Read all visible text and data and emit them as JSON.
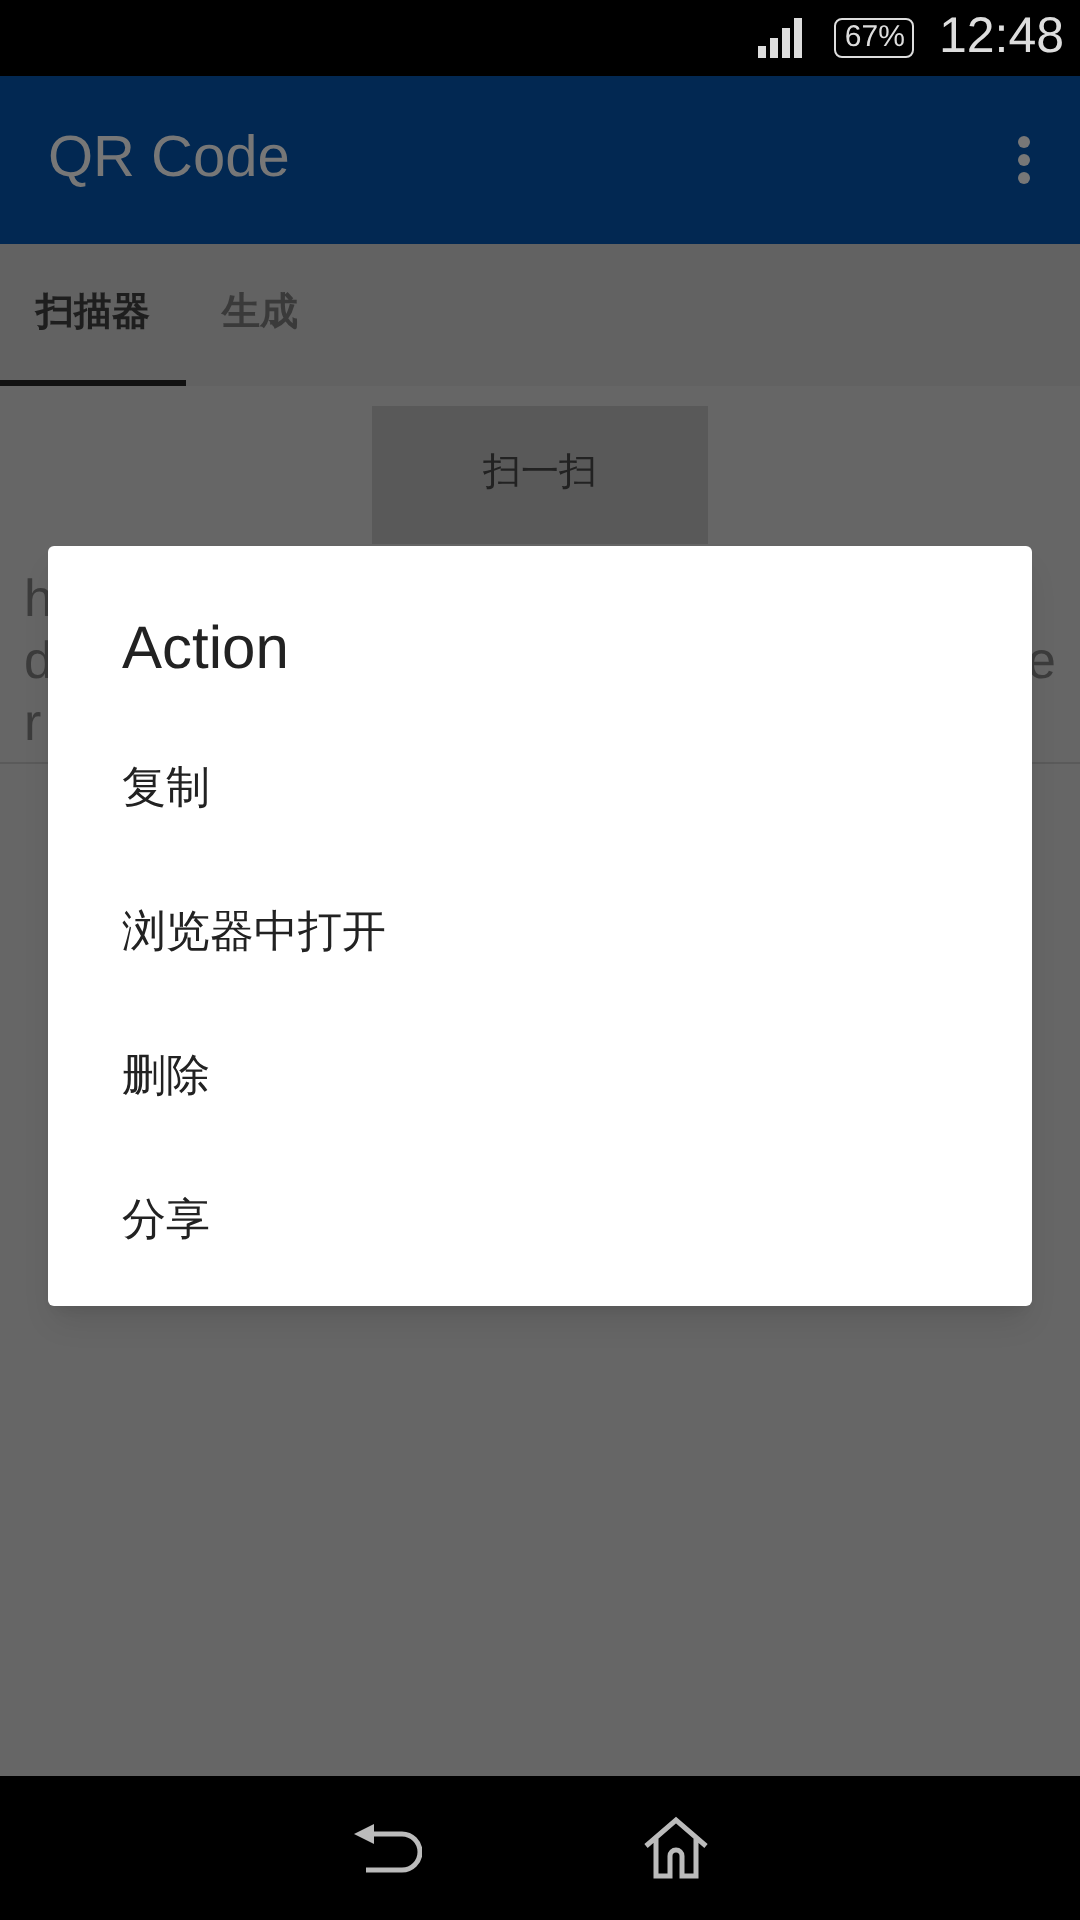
{
  "status_bar": {
    "battery": "67%",
    "time": "12:48"
  },
  "app_bar": {
    "title": "QR Code"
  },
  "tabs": [
    {
      "label": "扫描器",
      "selected": true
    },
    {
      "label": "生成",
      "selected": false
    }
  ],
  "scan_button": "扫一扫",
  "result_lines": [
    {
      "left": "h"
    },
    {
      "left": "d",
      "right": "e"
    },
    {
      "left": "r"
    }
  ],
  "dialog": {
    "title": "Action",
    "items": [
      "复制",
      "浏览器中打开",
      "删除",
      "分享"
    ]
  }
}
